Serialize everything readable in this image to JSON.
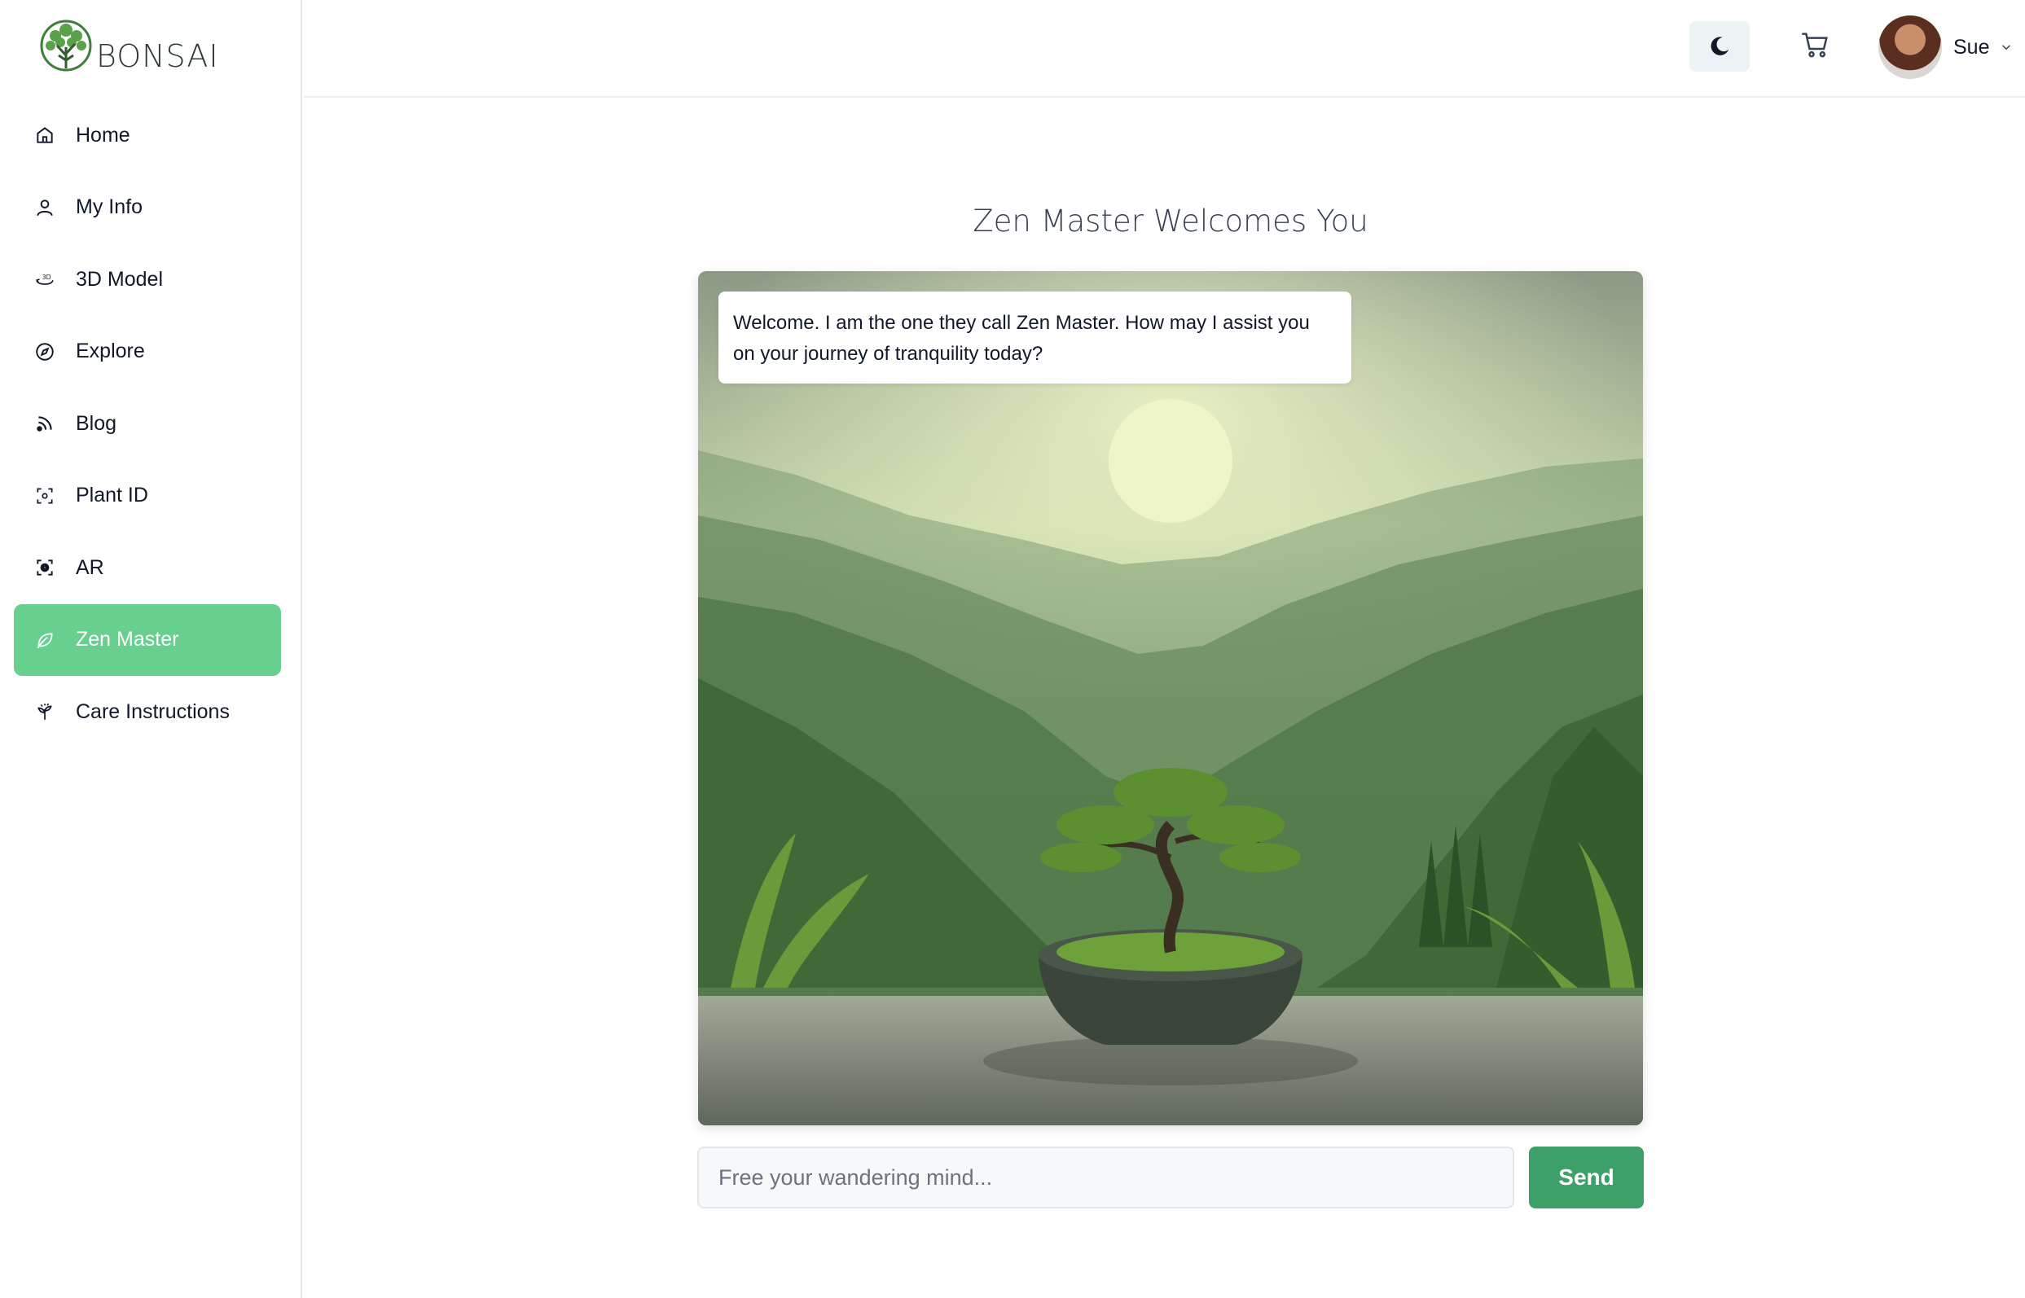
{
  "brand": {
    "name": "BONSAI"
  },
  "sidebar": {
    "items": [
      {
        "label": "Home",
        "icon": "home-icon",
        "active": false
      },
      {
        "label": "My Info",
        "icon": "user-icon",
        "active": false
      },
      {
        "label": "3D Model",
        "icon": "3d-rotate-icon",
        "active": false
      },
      {
        "label": "Explore",
        "icon": "compass-icon",
        "active": false
      },
      {
        "label": "Blog",
        "icon": "rss-icon",
        "active": false
      },
      {
        "label": "Plant ID",
        "icon": "scan-icon",
        "active": false
      },
      {
        "label": "AR",
        "icon": "ar-scan-icon",
        "active": false
      },
      {
        "label": "Zen Master",
        "icon": "leaf-icon",
        "active": true
      },
      {
        "label": "Care Instructions",
        "icon": "sprout-icon",
        "active": false
      }
    ]
  },
  "header": {
    "theme_toggle_icon": "moon-icon",
    "cart_icon": "cart-icon",
    "user_name": "Sue"
  },
  "main": {
    "title": "Zen Master Welcomes You",
    "message": "Welcome. I am the one they call Zen Master. How may I assist you on your journey of tranquility today?",
    "input_placeholder": "Free your wandering mind...",
    "input_value": "",
    "send_label": "Send"
  },
  "colors": {
    "active_nav": "#67d08f",
    "send_button": "#3ca068"
  }
}
